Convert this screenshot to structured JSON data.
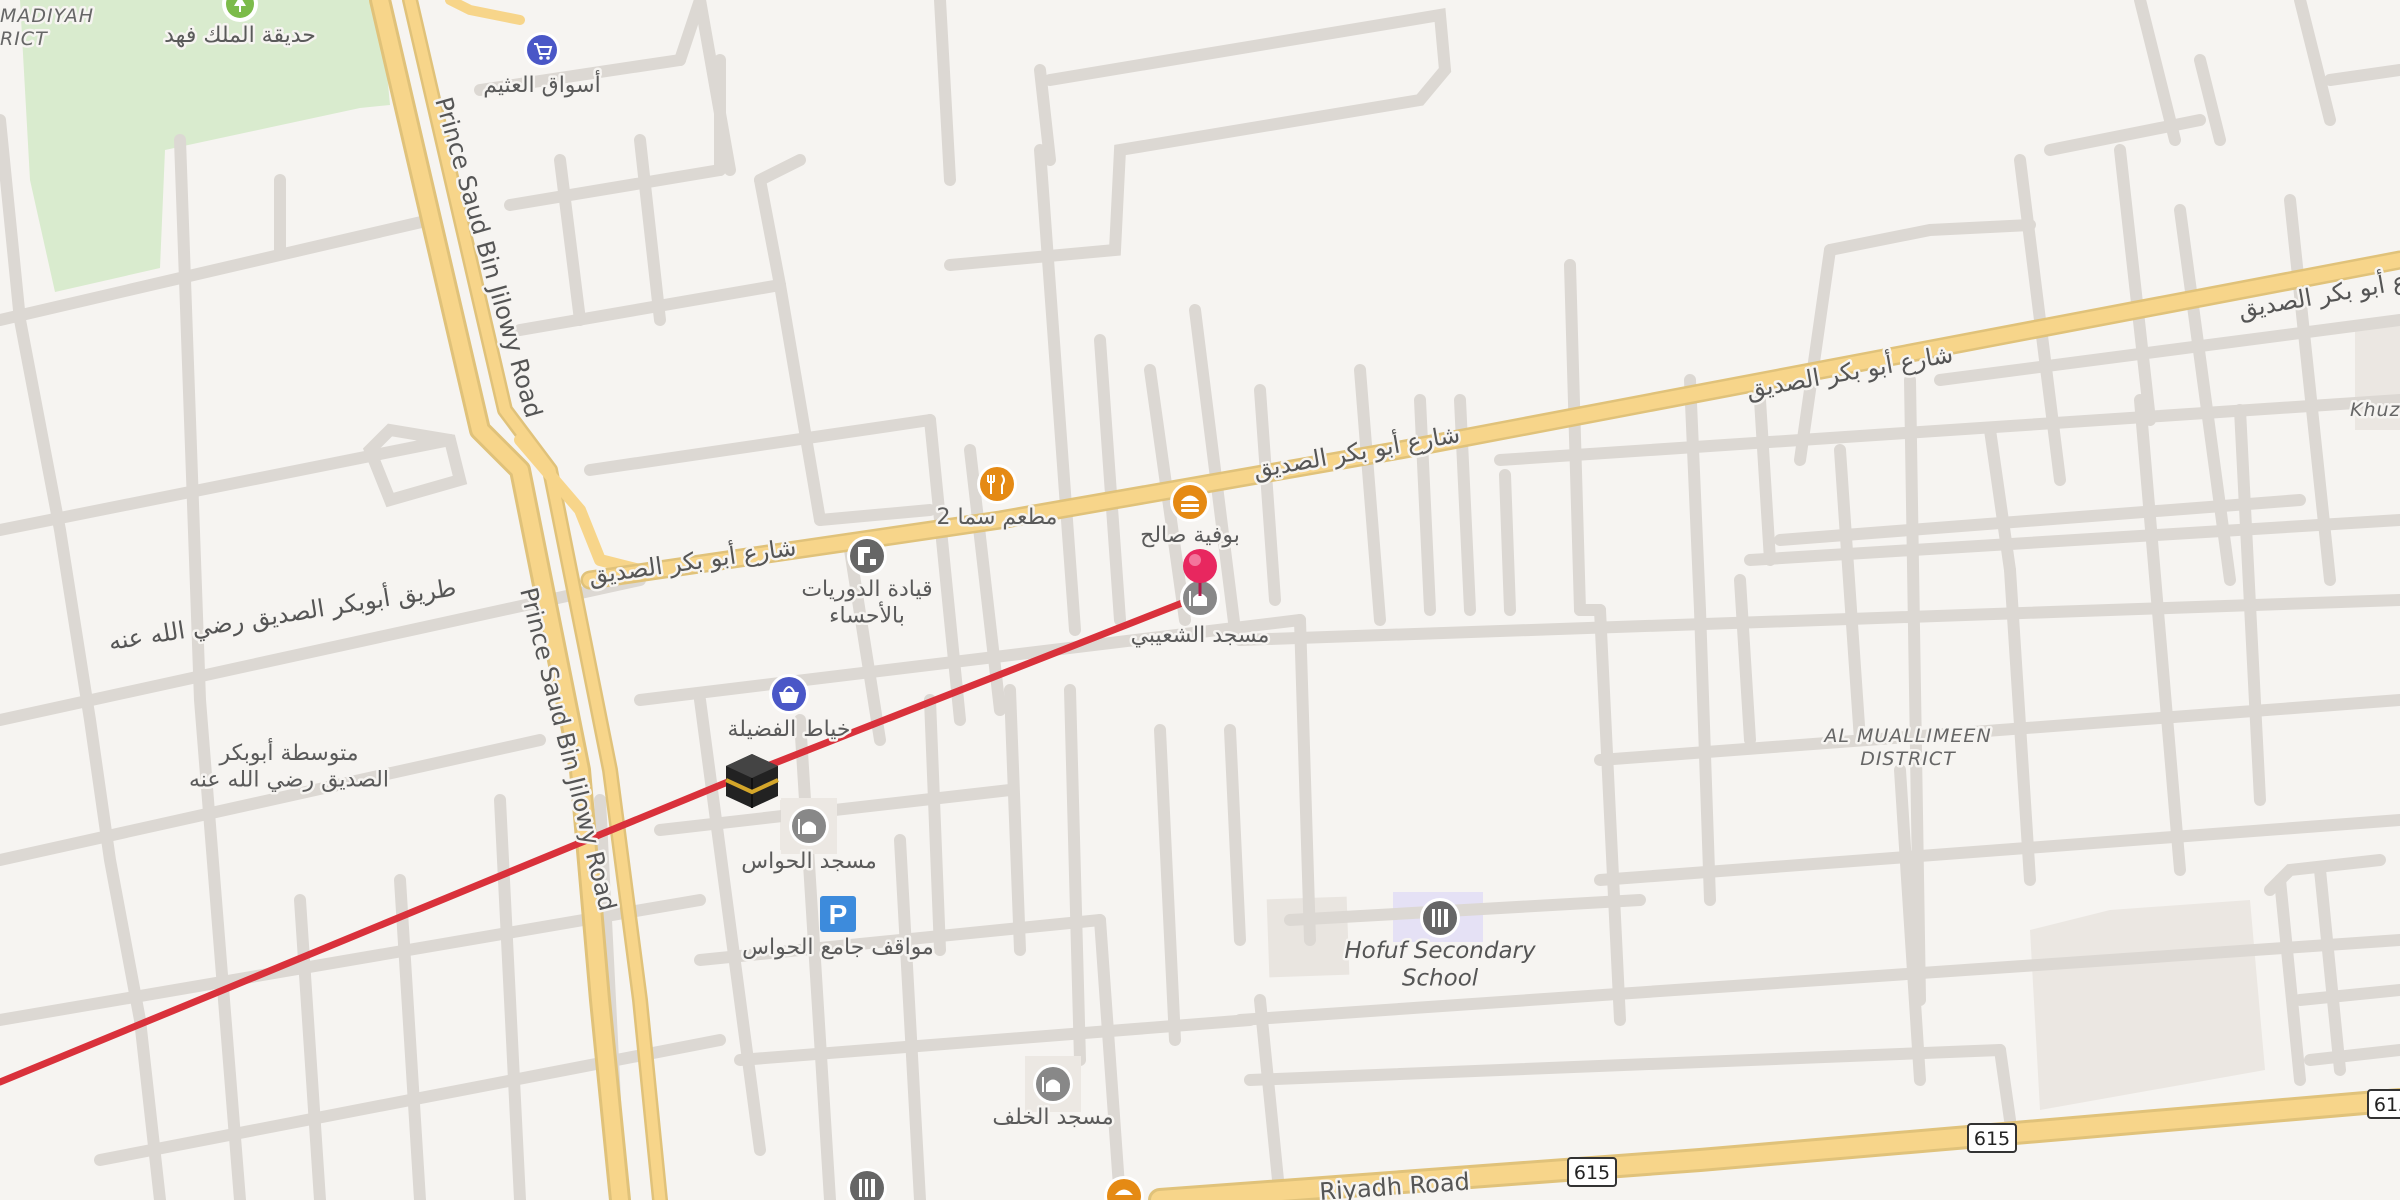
{
  "map": {
    "districts": {
      "top_left": "MADIYAH\nRICT",
      "muallimeen": "AL MUALLIMEEN\nDISTRICT",
      "khuz": "Khuz"
    },
    "roads": {
      "prince_saud_upper": "Prince Saud Bin Jilowy Road",
      "prince_saud_lower": "Prince Saud Bin Jilowy Road",
      "abu_bakr_right1": "شارع أبو بكر الصديق",
      "abu_bakr_right2": "شارع أبو بكر الصديق",
      "abu_bakr_mid": "شارع أبو بكر الصديق",
      "abu_bakr_left": "شارع أبو بكر الصديق",
      "abu_bakr_way": "طريق أبوبكر الصديق رضي الله عنه",
      "riyadh": "Riyadh Road",
      "route_615": "615"
    },
    "pois": {
      "park": "حديقة الملك فهد",
      "othaim": "أسواق العثيم",
      "restaurant": "مطعم سما 2",
      "buffet": "بوفية صالح",
      "patrol": "قيادة الدوريات\nبالأحساء",
      "mosque_shuaibi": "مسجد الشعيبي",
      "tailor": "خياط الفضيلة",
      "school_abubakr": "متوسطة أبوبكر\nالصديق رضي الله عنه",
      "mosque_hawas": "مسجد الحواس",
      "parking_hawas": "مواقف جامع الحواس",
      "hofuf_school": "Hofuf Secondary\nSchool",
      "mosque_khalaf": "مسجد الخلف"
    },
    "icons": {
      "pin": "location-pin-icon",
      "kaaba": "kaaba-icon",
      "mosque": "mosque-icon",
      "restaurant": "fork-knife-icon",
      "fast_food": "burger-icon",
      "cart": "shopping-cart-icon",
      "basket": "shopping-basket-icon",
      "parking": "parking-icon",
      "school": "school-icon",
      "police": "police-icon",
      "park": "tree-icon"
    },
    "colors": {
      "route": "#d9313b",
      "pin": "#e8275f",
      "major_road": "#f7d58a",
      "park": "#d9ebce",
      "background": "#f6f4f1"
    }
  }
}
